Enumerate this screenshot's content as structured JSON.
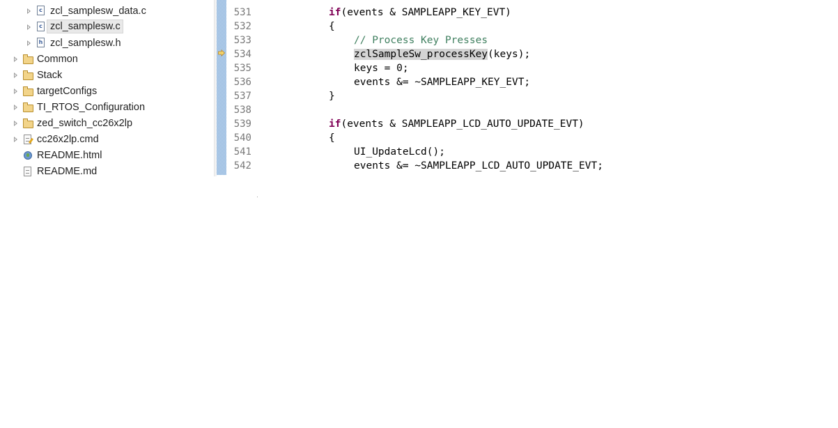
{
  "explorer": {
    "items": [
      {
        "label": "zcl_samplesw_data.c",
        "icon": "c-file-icon"
      },
      {
        "label": "zcl_samplesw.c",
        "icon": "c-file-icon",
        "selected": true
      },
      {
        "label": "zcl_samplesw.h",
        "icon": "h-file-icon"
      },
      {
        "label": "Common",
        "icon": "folder-icon"
      },
      {
        "label": "Stack",
        "icon": "folder-icon"
      },
      {
        "label": "targetConfigs",
        "icon": "folder-icon"
      },
      {
        "label": "TI_RTOS_Configuration",
        "icon": "folder-icon"
      },
      {
        "label": "zed_switch_cc26x2lp",
        "icon": "folder-icon"
      },
      {
        "label": "cc26x2lp.cmd",
        "icon": "cmd-file-icon"
      },
      {
        "label": "README.html",
        "icon": "html-file-icon"
      },
      {
        "label": "README.md",
        "icon": "text-file-icon"
      }
    ],
    "c_icon_letter": "c",
    "h_icon_letter": "h"
  },
  "editor": {
    "top_partial_line": "530",
    "lines": [
      {
        "num": "531",
        "keyword": "if",
        "text": "(events & SAMPLEAPP_KEY_EVT)"
      },
      {
        "num": "532",
        "text": "{"
      },
      {
        "num": "533",
        "comment": "// Process Key Presses"
      },
      {
        "num": "534",
        "highlight": "zclSampleSw_processKey",
        "text": "(keys);"
      },
      {
        "num": "535",
        "text": "keys = 0;"
      },
      {
        "num": "536",
        "text": "events &= ~SAMPLEAPP_KEY_EVT;"
      },
      {
        "num": "537",
        "text": "}"
      },
      {
        "num": "538",
        "text": ""
      },
      {
        "num": "539",
        "keyword": "if",
        "text": "(events & SAMPLEAPP_LCD_AUTO_UPDATE_EVT)"
      },
      {
        "num": "540",
        "text": "{"
      },
      {
        "num": "541",
        "text": "UI_UpdateLcd();"
      },
      {
        "num": "542",
        "text": "events &= ~SAMPLEAPP_LCD_AUTO_UPDATE_EVT;"
      }
    ],
    "current_line": "538",
    "debug_line": "534",
    "colors": {
      "keyword": "#7f0055",
      "comment": "#3f7f5f",
      "current_line_bg": "#e8f0fb",
      "ruler": "#89b1dc"
    }
  }
}
